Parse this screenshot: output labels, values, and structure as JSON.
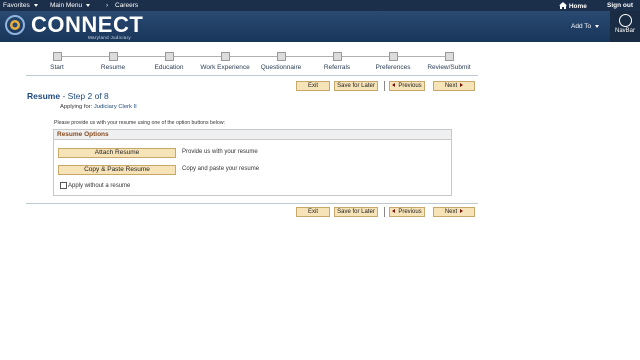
{
  "topbar": {
    "favorites": "Favorites",
    "main_menu": "Main Menu",
    "breadcrumb_sep": "›",
    "breadcrumb": "Careers",
    "home": "Home",
    "sign_out": "Sign out"
  },
  "banner": {
    "logo": "CONNECT",
    "logo_sub": "Maryland Judiciary",
    "add_to": "Add To",
    "navbar": "NavBar"
  },
  "steps": [
    {
      "label": "Start",
      "state": "done"
    },
    {
      "label": "Resume",
      "state": "active"
    },
    {
      "label": "Education",
      "state": "todo"
    },
    {
      "label": "Work Experience",
      "state": "todo"
    },
    {
      "label": "Questionnaire",
      "state": "todo"
    },
    {
      "label": "Referrals",
      "state": "todo"
    },
    {
      "label": "Preferences",
      "state": "todo"
    },
    {
      "label": "Review/Submit",
      "state": "todo"
    }
  ],
  "buttons": {
    "exit": "Exit",
    "save_for_later": "Save for Later",
    "previous": "Previous",
    "next": "Next"
  },
  "page": {
    "title": "Resume",
    "step_text": " - Step 2 of 8",
    "applying_label": "Applying for:",
    "applying_value": "Judiciary Clerk II",
    "instructions": "Please provide us with your resume using one of the option buttons below:"
  },
  "resume_options": {
    "header": "Resume Options",
    "attach_button": "Attach Resume",
    "attach_desc": "Provide us with your resume",
    "paste_button": "Copy & Paste Resume",
    "paste_desc": "Copy and paste your resume",
    "no_resume_label": "Apply without a resume",
    "no_resume_checked": false
  },
  "colors": {
    "topbar": "#1c2f4a",
    "banner": "#2a4a72",
    "accent": "#1f4a7d",
    "button_fill": "#f7e3b8"
  }
}
